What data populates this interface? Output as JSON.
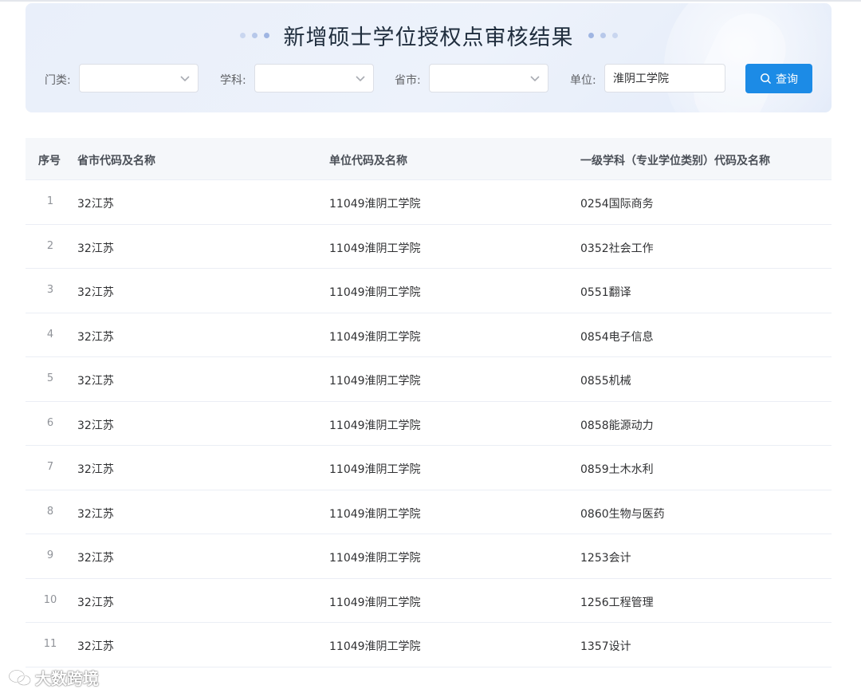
{
  "page": {
    "title": "新增硕士学位授权点审核结果"
  },
  "filters": {
    "category_label": "门类:",
    "discipline_label": "学科:",
    "province_label": "省市:",
    "unit_label": "单位:",
    "unit_value": "淮阴工学院",
    "query_label": "查询"
  },
  "table": {
    "headers": [
      "序号",
      "省市代码及名称",
      "单位代码及名称",
      "一级学科（专业学位类别）代码及名称"
    ],
    "rows": [
      [
        "1",
        "32江苏",
        "11049淮阴工学院",
        "0254国际商务"
      ],
      [
        "2",
        "32江苏",
        "11049淮阴工学院",
        "0352社会工作"
      ],
      [
        "3",
        "32江苏",
        "11049淮阴工学院",
        "0551翻译"
      ],
      [
        "4",
        "32江苏",
        "11049淮阴工学院",
        "0854电子信息"
      ],
      [
        "5",
        "32江苏",
        "11049淮阴工学院",
        "0855机械"
      ],
      [
        "6",
        "32江苏",
        "11049淮阴工学院",
        "0858能源动力"
      ],
      [
        "7",
        "32江苏",
        "11049淮阴工学院",
        "0859土木水利"
      ],
      [
        "8",
        "32江苏",
        "11049淮阴工学院",
        "0860生物与医药"
      ],
      [
        "9",
        "32江苏",
        "11049淮阴工学院",
        "1253会计"
      ],
      [
        "10",
        "32江苏",
        "11049淮阴工学院",
        "1256工程管理"
      ],
      [
        "11",
        "32江苏",
        "11049淮阴工学院",
        "1357设计"
      ]
    ]
  },
  "watermark": {
    "text": "大数跨境"
  },
  "colors": {
    "accent": "#1c8be6",
    "banner_bg": "#e9effa",
    "header_bg": "#f5f7fa"
  },
  "icons": {
    "select_arrow": "chevron-down-icon",
    "query": "search-icon",
    "watermark": "wechat-logo-icon"
  }
}
